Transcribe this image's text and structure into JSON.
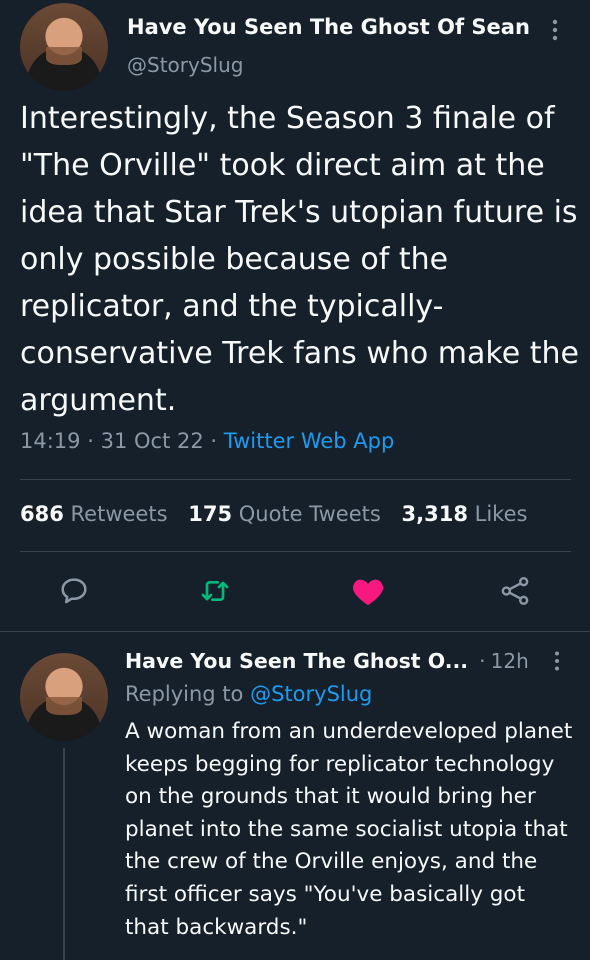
{
  "main_tweet": {
    "author_name": "Have You Seen The Ghost Of Sean",
    "handle": "@StorySlug",
    "text": "Interestingly, the Season 3 finale of \"The Orville\" took direct aim at the idea that Star Trek's utopian future is only possible because of the replicator, and the typically-conservative Trek fans who make the argument.",
    "time": "14:19",
    "date": "31 Oct 22",
    "separator": "·",
    "source_app": "Twitter Web App"
  },
  "stats": {
    "retweets_count": "686",
    "retweets_label": "Retweets",
    "quotes_count": "175",
    "quotes_label": "Quote Tweets",
    "likes_count": "3,318",
    "likes_label": "Likes"
  },
  "actions": [
    {
      "icon": "reply-icon",
      "color": "#8b98a5"
    },
    {
      "icon": "retweet-icon",
      "color": "#00ba7c"
    },
    {
      "icon": "heart-filled-icon",
      "color": "#f91880"
    },
    {
      "icon": "share-icon",
      "color": "#8b98a5"
    }
  ],
  "reply": {
    "author_name": "Have You Seen The Ghost O...",
    "separator": "·",
    "age": "12h",
    "replying_prefix": "Replying to",
    "replying_to": "@StorySlug",
    "text": "A woman from an underdeveloped planet keeps begging for replicator technology on the grounds that it would bring her planet into the same socialist utopia that the crew of the Orville enjoys, and the first officer says \"You've basically got that backwards.\""
  },
  "colors": {
    "background": "#15202b",
    "text": "#f7f9f9",
    "secondary": "#8b98a5",
    "link": "#1d9bf0",
    "divider": "#38444d"
  }
}
